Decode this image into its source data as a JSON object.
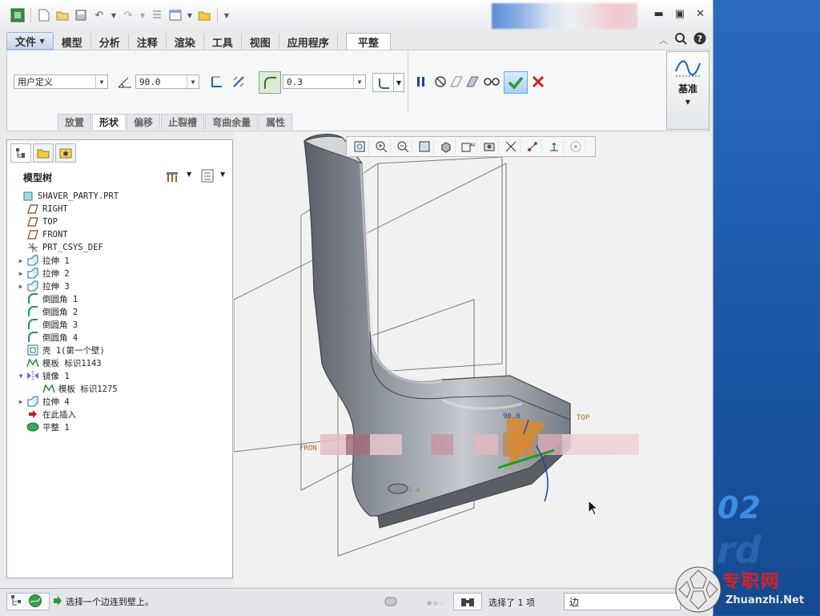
{
  "tabs": {
    "file": "文件",
    "items": [
      "模型",
      "分析",
      "注释",
      "渲染",
      "工具",
      "视图",
      "应用程序"
    ],
    "active": "平整"
  },
  "ribbon": {
    "shape_combo": "用户定义",
    "angle_value": "90.0",
    "radius_value": "0.3",
    "datum_label": "基准",
    "sub_tabs": [
      "放置",
      "形状",
      "偏移",
      "止裂槽",
      "弯曲余量",
      "属性"
    ],
    "active_sub_tab": "形状"
  },
  "panel": {
    "title": "模型树"
  },
  "tree": [
    {
      "label": "SHAVER_PARTY.PRT",
      "icon": "part-icon",
      "expand": "",
      "indent": 0
    },
    {
      "label": "RIGHT",
      "icon": "datum-plane-icon",
      "expand": "",
      "indent": 1
    },
    {
      "label": "TOP",
      "icon": "datum-plane-icon",
      "expand": "",
      "indent": 1
    },
    {
      "label": "FRONT",
      "icon": "datum-plane-icon",
      "expand": "",
      "indent": 1
    },
    {
      "label": "PRT_CSYS_DEF",
      "icon": "csys-icon",
      "expand": "",
      "indent": 1
    },
    {
      "label": "拉伸 1",
      "icon": "extrude-icon",
      "expand": "▶",
      "indent": 1
    },
    {
      "label": "拉伸 2",
      "icon": "extrude-icon",
      "expand": "▶",
      "indent": 1
    },
    {
      "label": "拉伸 3",
      "icon": "extrude-icon",
      "expand": "▶",
      "indent": 1
    },
    {
      "label": "倒圆角 1",
      "icon": "round-icon",
      "expand": "",
      "indent": 1
    },
    {
      "label": "倒圆角 2",
      "icon": "round-icon",
      "expand": "",
      "indent": 1
    },
    {
      "label": "倒圆角 3",
      "icon": "round-icon",
      "expand": "",
      "indent": 1
    },
    {
      "label": "倒圆角 4",
      "icon": "round-icon",
      "expand": "",
      "indent": 1
    },
    {
      "label": "壳 1(第一个壁)",
      "icon": "shell-icon",
      "expand": "",
      "indent": 1
    },
    {
      "label": "模板 标识1143",
      "icon": "template-icon",
      "expand": "",
      "indent": 1
    },
    {
      "label": "镜像 1",
      "icon": "mirror-icon",
      "expand": "▼",
      "indent": 1
    },
    {
      "label": "模板 标识1275",
      "icon": "template-icon",
      "expand": "",
      "indent": 2
    },
    {
      "label": "拉伸 4",
      "icon": "extrude-icon",
      "expand": "▶",
      "indent": 1
    },
    {
      "label": "在此插入",
      "icon": "insert-arrow-icon",
      "expand": "",
      "indent": 1
    },
    {
      "label": "平整 1",
      "icon": "flatten-icon",
      "expand": "",
      "indent": 1
    }
  ],
  "viewport": {
    "datum_top": "TOP",
    "datum_front": "FRON",
    "dim_angle": "90.0",
    "dim_small": "1.4"
  },
  "status": {
    "message": "选择一个边连到壁上。",
    "selected": "选择了 1 项",
    "filter": "边"
  },
  "watermark": {
    "cn": "专职网",
    "en": "Zhuanzhi.Net",
    "bg_number": "02",
    "bg_letters": "rd"
  },
  "colors": {
    "confirm": "#2a9a3a",
    "cancel": "#d42020",
    "pause": "#1f3fa0"
  }
}
